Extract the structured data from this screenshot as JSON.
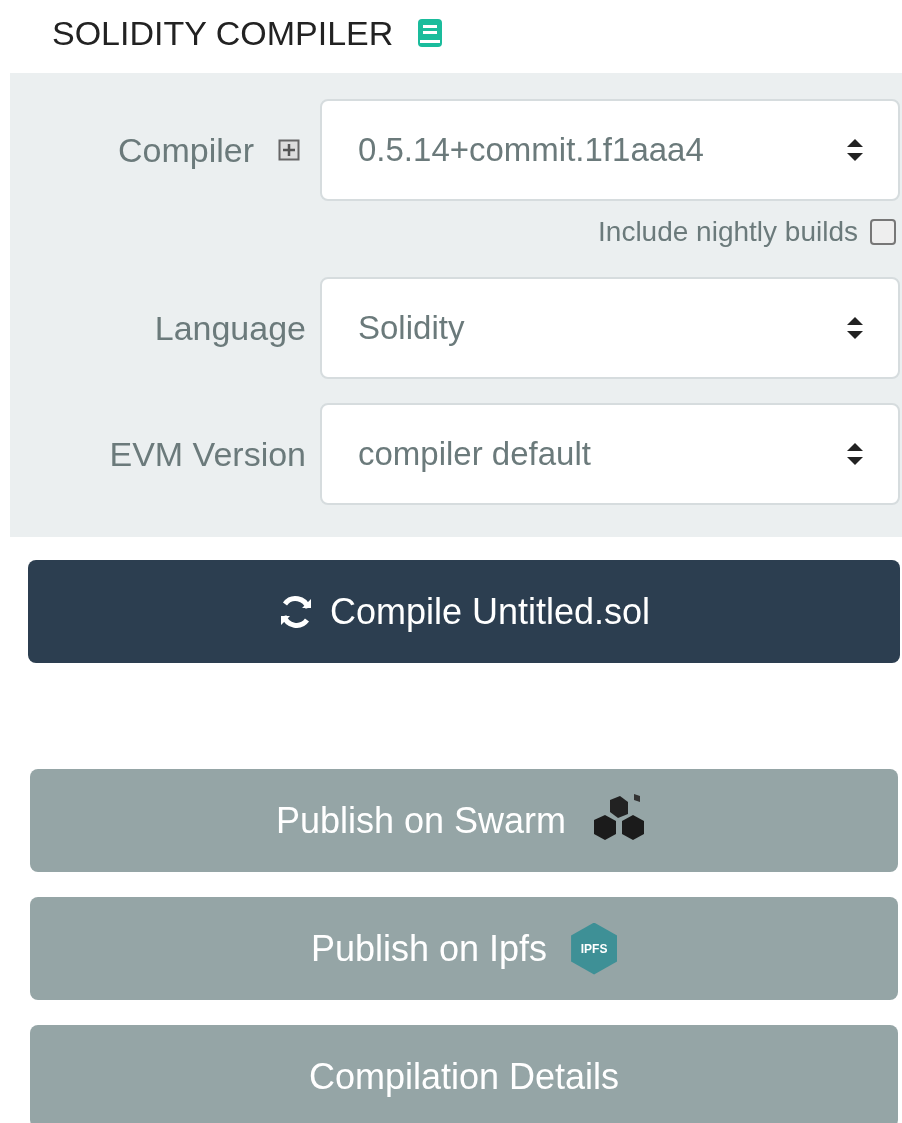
{
  "title": "SOLIDITY COMPILER",
  "fields": [
    {
      "label": "Compiler",
      "value": "0.5.14+commit.1f1aaa4",
      "expandable": true
    },
    {
      "label": "Language",
      "value": "Solidity",
      "expandable": false
    },
    {
      "label": "EVM Version",
      "value": "compiler default",
      "expandable": false
    }
  ],
  "nightly": {
    "label": "Include nightly builds",
    "checked": false
  },
  "compile_button": {
    "label": "Compile Untitled.sol"
  },
  "publish_buttons": [
    {
      "label": "Publish on Swarm",
      "kind": "swarm"
    },
    {
      "label": "Publish on Ipfs",
      "kind": "ipfs",
      "logo_text": "IPFS"
    },
    {
      "label": "Compilation Details",
      "kind": "plain"
    }
  ]
}
